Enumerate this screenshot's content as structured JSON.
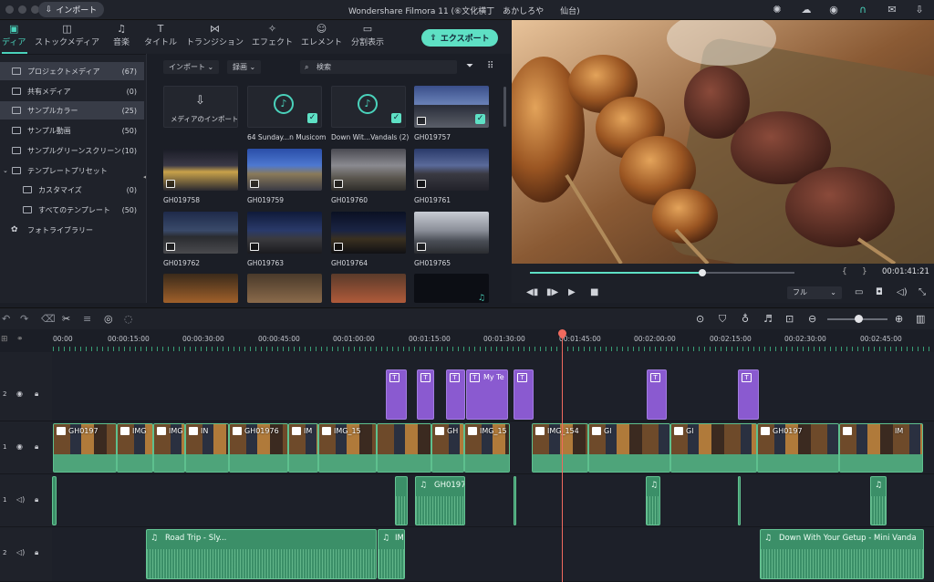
{
  "titlebar": {
    "import_label": "インポート",
    "app_title": "Wondershare Filmora 11 (⑥文化横丁　あかしろや　　仙台)"
  },
  "tabs": [
    {
      "label": "ディア",
      "icon": "media-icon"
    },
    {
      "label": "ストックメディア",
      "icon": "stock-media-icon"
    },
    {
      "label": "音楽",
      "icon": "music-icon"
    },
    {
      "label": "タイトル",
      "icon": "title-icon"
    },
    {
      "label": "トランジション",
      "icon": "transition-icon"
    },
    {
      "label": "エフェクト",
      "icon": "effect-icon"
    },
    {
      "label": "エレメント",
      "icon": "element-icon"
    },
    {
      "label": "分割表示",
      "icon": "split-screen-icon"
    }
  ],
  "export_label": "エクスポート",
  "sidebar": [
    {
      "label": "プロジェクトメディア",
      "count": "(67)"
    },
    {
      "label": "共有メディア",
      "count": "(0)"
    },
    {
      "label": "サンプルカラー",
      "count": "(25)"
    },
    {
      "label": "サンプル動画",
      "count": "(50)"
    },
    {
      "label": "サンプルグリーンスクリーン",
      "count": "(10)"
    },
    {
      "label": "テンプレートプリセット",
      "count": ""
    },
    {
      "label": "カスタマイズ",
      "count": "(0)"
    },
    {
      "label": "すべてのテンプレート",
      "count": "(50)"
    },
    {
      "label": "フォトライブラリー",
      "count": ""
    }
  ],
  "media_toolbar": {
    "import_dropdown": "インポート",
    "filter_dropdown": "録画",
    "search_placeholder": "検索"
  },
  "media_tiles": [
    {
      "label": "",
      "caption": "メディアのインポート"
    },
    {
      "label": "64 Sunday...n Musicom"
    },
    {
      "label": "Down Wit...Vandals (2)"
    },
    {
      "label": "GH019757"
    },
    {
      "label": "GH019758"
    },
    {
      "label": "GH019759"
    },
    {
      "label": "GH019760"
    },
    {
      "label": "GH019761"
    },
    {
      "label": "GH019762"
    },
    {
      "label": "GH019763"
    },
    {
      "label": "GH019764"
    },
    {
      "label": "GH019765"
    }
  ],
  "player": {
    "timecode": "00:01:41:21",
    "quality": "フル",
    "progress": 0.65
  },
  "ruler": [
    "00:00",
    "00:00:15:00",
    "00:00:30:00",
    "00:00:45:00",
    "00:01:00:00",
    "00:01:15:00",
    "00:01:30:00",
    "00:01:45:00",
    "00:02:00:00",
    "00:02:15:00",
    "00:02:30:00",
    "00:02:45:00"
  ],
  "tracks": {
    "title_track_num": "2",
    "video_track_num": "1",
    "audio1_num": "1",
    "audio2_num": "2"
  },
  "title_clips": [
    "",
    "",
    "",
    "My Te",
    "",
    "",
    ""
  ],
  "video_clips": [
    "GH0197",
    "IMG",
    "IMG",
    "IN",
    "GH01976",
    "IM",
    "IMG_15",
    "GH",
    "IMG_15",
    "IMG_154",
    "Gl",
    "Gl",
    "GH0197",
    "IM"
  ],
  "audio_clips": {
    "a1": "GH0197",
    "a2_1": "Road Trip - Sly...",
    "a2_2": "IM",
    "a2_3": "Down With Your Getup - Mini Vanda"
  }
}
